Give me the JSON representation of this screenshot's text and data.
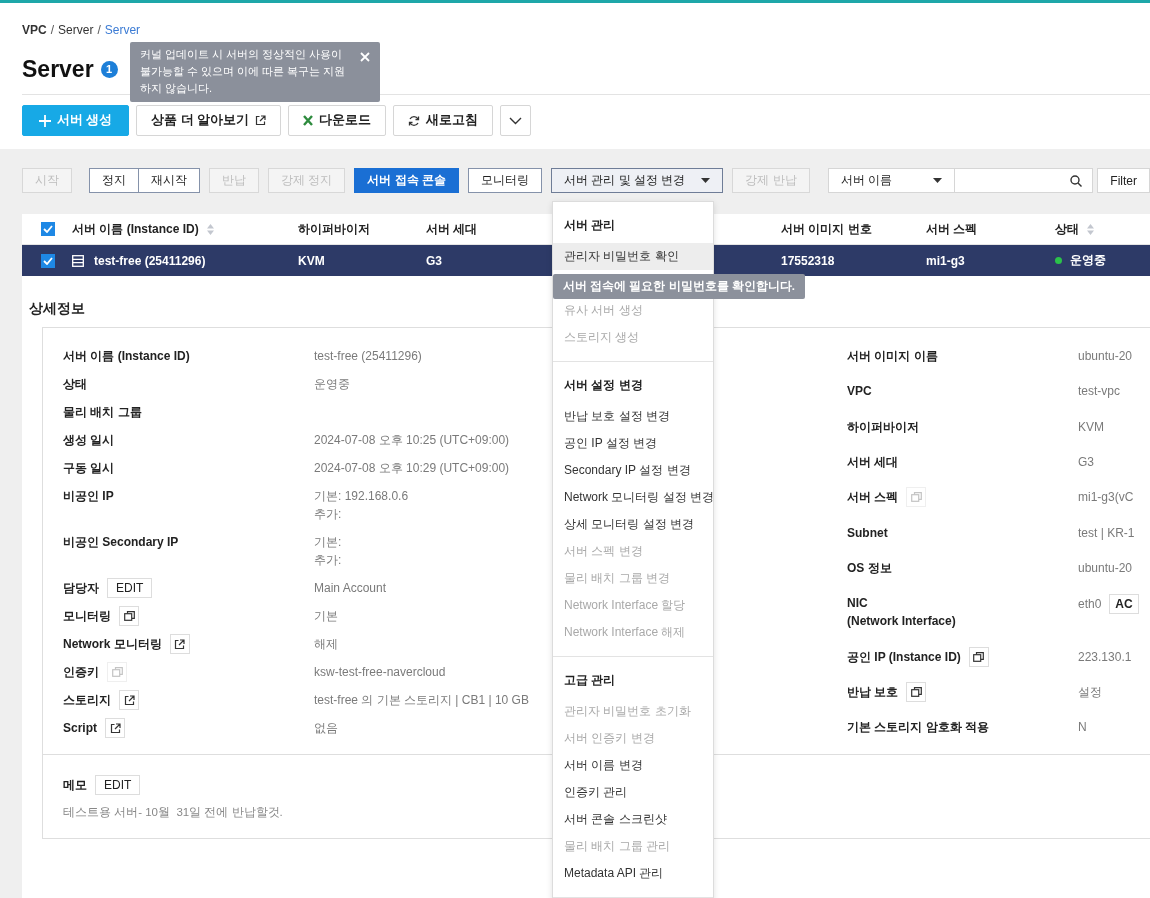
{
  "breadcrumb": [
    {
      "label": "VPC",
      "current": false
    },
    {
      "label": "Server",
      "current": false
    },
    {
      "label": "Server",
      "current": true
    }
  ],
  "separator": "/",
  "page_title": "Server",
  "notice": {
    "count": "1",
    "text": "커널 업데이트 시 서버의 정상적인 사용이 불가능할 수 있으며 이에 따른 복구는 지원하지 않습니다."
  },
  "header_buttons": [
    {
      "label": "서버 생성",
      "kind": "create"
    },
    {
      "label": "상품 더 알아보기",
      "kind": "external"
    },
    {
      "label": "다운로드",
      "kind": "download"
    },
    {
      "label": "새로고침",
      "kind": "refresh"
    },
    {
      "kind": "more"
    }
  ],
  "actions": [
    {
      "buttons": [
        {
          "label": "시작",
          "kind": "default",
          "disabled": true
        }
      ]
    },
    {
      "buttons": [
        {
          "label": "정지",
          "kind": "default",
          "disabled": false
        },
        {
          "label": "재시작",
          "kind": "default",
          "disabled": false
        }
      ]
    },
    {
      "buttons": [
        {
          "label": "반납",
          "kind": "default",
          "disabled": true
        }
      ]
    },
    {
      "buttons": [
        {
          "label": "강제 정지",
          "kind": "default",
          "disabled": true
        }
      ]
    },
    {
      "buttons": [
        {
          "label": "서버 접속 콘솔",
          "kind": "primary",
          "disabled": false
        }
      ]
    },
    {
      "buttons": [
        {
          "label": "모니터링",
          "kind": "default",
          "disabled": false
        }
      ]
    },
    {
      "buttons": [
        {
          "label": "서버 관리 및 설정 변경",
          "kind": "dropdown",
          "disabled": false,
          "open": true
        }
      ]
    },
    {
      "buttons": [
        {
          "label": "강제 반납",
          "kind": "default",
          "disabled": true
        }
      ]
    }
  ],
  "search": {
    "field": "서버 이름",
    "filter": "Filter"
  },
  "menu": {
    "sections": [
      {
        "title": "서버 관리",
        "items": [
          {
            "label": "관리자 비밀번호 확인",
            "disabled": false,
            "hovered": true,
            "tooltip": "서버 접속에 필요한 비밀번호를 확인합니다."
          },
          {
            "label": "유사 서버 생성",
            "disabled": true,
            "hovered": false
          },
          {
            "label": "스토리지 생성",
            "disabled": true,
            "hovered": false
          }
        ]
      },
      {
        "title": "서버 설정 변경",
        "items": [
          {
            "label": "반납 보호 설정 변경",
            "disabled": false,
            "hovered": false
          },
          {
            "label": "공인 IP 설정 변경",
            "disabled": false,
            "hovered": false
          },
          {
            "label": "Secondary IP 설정 변경",
            "disabled": false,
            "hovered": false
          },
          {
            "label": "Network 모니터링 설정 변경",
            "disabled": false,
            "hovered": false
          },
          {
            "label": "상세 모니터링 설정 변경",
            "disabled": false,
            "hovered": false
          },
          {
            "label": "서버 스펙 변경",
            "disabled": true,
            "hovered": false
          },
          {
            "label": "물리 배치 그룹 변경",
            "disabled": true,
            "hovered": false
          },
          {
            "label": "Network Interface 할당",
            "disabled": true,
            "hovered": false
          },
          {
            "label": "Network Interface 해제",
            "disabled": true,
            "hovered": false
          }
        ]
      },
      {
        "title": "고급 관리",
        "items": [
          {
            "label": "관리자 비밀번호 초기화",
            "disabled": true,
            "hovered": false
          },
          {
            "label": "서버 인증키 변경",
            "disabled": true,
            "hovered": false
          },
          {
            "label": "서버 이름 변경",
            "disabled": false,
            "hovered": false
          },
          {
            "label": "인증키 관리",
            "disabled": false,
            "hovered": false
          },
          {
            "label": "서버 콘솔 스크린샷",
            "disabled": false,
            "hovered": false
          },
          {
            "label": "물리 배치 그룹 관리",
            "disabled": true,
            "hovered": false
          },
          {
            "label": "Metadata API 관리",
            "disabled": false,
            "hovered": false
          }
        ]
      }
    ]
  },
  "table": {
    "all_checked": true,
    "columns": [
      {
        "label": "서버 이름 (Instance ID)",
        "sortable": true
      },
      {
        "label": "하이퍼바이저",
        "sortable": false
      },
      {
        "label": "서버 세대",
        "sortable": false
      },
      {
        "label": "서버 이미지 번호",
        "sortable": false
      },
      {
        "label": "서버 스펙",
        "sortable": false
      },
      {
        "label": "상태",
        "sortable": true
      }
    ],
    "rows": [
      {
        "selected": true,
        "checked": true,
        "cells": [
          "test-free (25411296)",
          "KVM",
          "G3",
          "17552318",
          "mi1-g3"
        ],
        "status": {
          "label": "운영중",
          "color": "#2bc24a"
        }
      }
    ]
  },
  "details": {
    "title": "상세정보",
    "left": [
      {
        "label": "서버 이름 (Instance ID)",
        "values": [
          "test-free (25411296)"
        ]
      },
      {
        "label": "상태",
        "values": [
          "운영중"
        ]
      },
      {
        "label": "물리 배치 그룹"
      },
      {
        "label": "생성 일시",
        "values": [
          "2024-07-08 오후 10:25 (UTC+09:00)"
        ]
      },
      {
        "label": "구동 일시",
        "values": [
          "2024-07-08 오후 10:29 (UTC+09:00)"
        ]
      },
      {
        "label": "비공인 IP",
        "values": [
          "기본: 192.168.0.6",
          "추가:"
        ]
      },
      {
        "label": "비공인 Secondary IP",
        "values": [
          "기본:",
          "추가:"
        ]
      },
      {
        "label": "담당자",
        "action": {
          "kind": "edit",
          "label": "EDIT"
        },
        "values": [
          "Main Account"
        ]
      },
      {
        "label": "모니터링",
        "action": {
          "kind": "copy",
          "disabled": false
        },
        "values": [
          "기본"
        ]
      },
      {
        "label": "Network 모니터링",
        "action": {
          "kind": "external",
          "disabled": false
        },
        "values": [
          "해제"
        ]
      },
      {
        "label": "인증키",
        "action": {
          "kind": "copy",
          "disabled": true
        },
        "values": [
          "ksw-test-free-navercloud"
        ]
      },
      {
        "label": "스토리지",
        "action": {
          "kind": "external",
          "disabled": false
        },
        "values": [
          "test-free 의 기본 스토리지 | CB1 | 10 GB"
        ]
      },
      {
        "label": "Script",
        "action": {
          "kind": "external",
          "disabled": false
        },
        "values": [
          "없음"
        ]
      }
    ],
    "right": [
      {
        "label": "서버 이미지 이름",
        "values": [
          "ubuntu-20"
        ]
      },
      {
        "label": "VPC",
        "values": [
          "test-vpc"
        ]
      },
      {
        "label": "하이퍼바이저",
        "values": [
          "KVM"
        ]
      },
      {
        "label": "서버 세대",
        "values": [
          "G3"
        ]
      },
      {
        "label": "서버 스펙",
        "action": {
          "kind": "copy",
          "disabled": true
        },
        "values": [
          "mi1-g3(vC"
        ]
      },
      {
        "label": "Subnet",
        "values": [
          "test | KR-1"
        ]
      },
      {
        "label": "OS 정보",
        "values": [
          "ubuntu-20"
        ]
      },
      {
        "label": "NIC\n(Network Interface)",
        "values": [
          "eth0"
        ],
        "button": "AC"
      },
      {
        "label": "공인 IP (Instance ID)",
        "action": {
          "kind": "copy",
          "disabled": false
        },
        "values": [
          "223.130.1"
        ]
      },
      {
        "label": "반납 보호",
        "action": {
          "kind": "copy",
          "disabled": false
        },
        "values": [
          "설정"
        ]
      },
      {
        "label": "기본 스토리지 암호화 적용",
        "values": [
          "N"
        ]
      }
    ],
    "memo": {
      "label": "메모",
      "action": "EDIT",
      "text": "테스트용 서버- 10월  31일 전에 반납할것."
    }
  }
}
